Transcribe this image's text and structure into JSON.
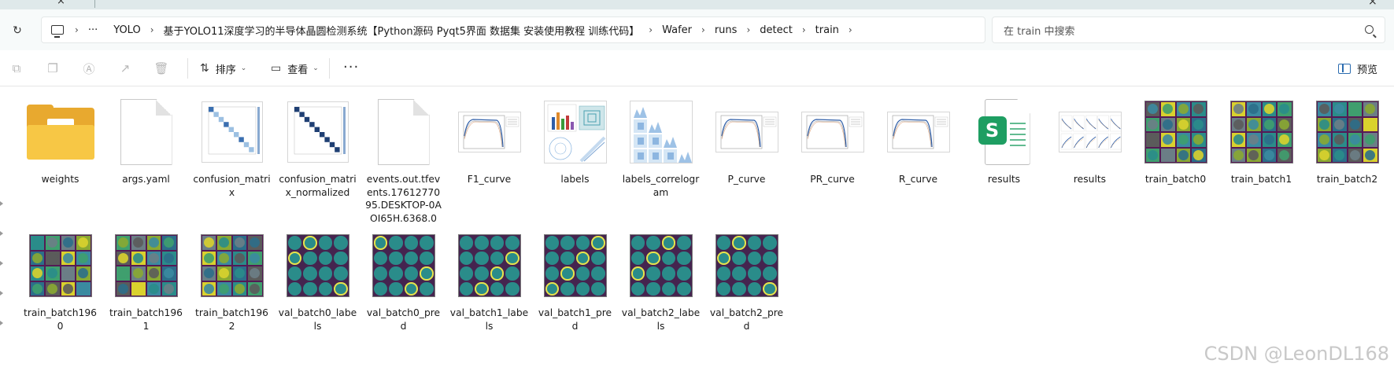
{
  "address_bar": {
    "breadcrumbs": [
      "YOLO",
      "基于YOLO11深度学习的半导体晶圆检测系统【Python源码 Pyqt5界面 数据集 安装使用教程 训练代码】",
      "Wafer",
      "runs",
      "detect",
      "train"
    ],
    "overflow": "···"
  },
  "search": {
    "placeholder": "在 train 中搜索"
  },
  "toolbar": {
    "sort_label": "排序",
    "view_label": "查看",
    "more_label": "···",
    "preview_label": "预览"
  },
  "files": [
    {
      "name": "weights",
      "kind": "folder"
    },
    {
      "name": "args.yaml",
      "kind": "file"
    },
    {
      "name": "confusion_matrix",
      "kind": "matrix"
    },
    {
      "name": "confusion_matrix_normalized",
      "kind": "matrix"
    },
    {
      "name": "events.out.tfevents.1761277095.DESKTOP-0AOI65H.6368.0",
      "kind": "file"
    },
    {
      "name": "F1_curve",
      "kind": "curve"
    },
    {
      "name": "labels",
      "kind": "labels"
    },
    {
      "name": "labels_correlogram",
      "kind": "correlogram"
    },
    {
      "name": "P_curve",
      "kind": "curve"
    },
    {
      "name": "PR_curve",
      "kind": "curve"
    },
    {
      "name": "R_curve",
      "kind": "curve"
    },
    {
      "name": "results",
      "kind": "excel"
    },
    {
      "name": "results",
      "kind": "results-png"
    },
    {
      "name": "train_batch0",
      "kind": "batch"
    },
    {
      "name": "train_batch1",
      "kind": "batch"
    },
    {
      "name": "train_batch2",
      "kind": "batch"
    },
    {
      "name": "train_batch1960",
      "kind": "batch"
    },
    {
      "name": "train_batch1961",
      "kind": "batch"
    },
    {
      "name": "train_batch1962",
      "kind": "batch"
    },
    {
      "name": "val_batch0_labels",
      "kind": "val"
    },
    {
      "name": "val_batch0_pred",
      "kind": "val"
    },
    {
      "name": "val_batch1_labels",
      "kind": "val"
    },
    {
      "name": "val_batch1_pred",
      "kind": "val"
    },
    {
      "name": "val_batch2_labels",
      "kind": "val"
    },
    {
      "name": "val_batch2_pred",
      "kind": "val"
    }
  ],
  "watermark": "CSDN @LeonDL168"
}
